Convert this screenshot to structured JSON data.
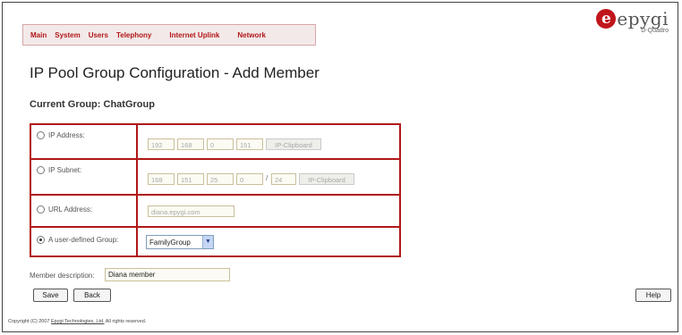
{
  "nav": {
    "items": [
      "Main",
      "System",
      "Users",
      "Telephony",
      "Internet Uplink",
      "Network"
    ]
  },
  "logo": {
    "text": "epygi",
    "subtext": "D-Quadro"
  },
  "page": {
    "title": "IP Pool Group Configuration - Add Member",
    "subtitle": "Current Group: ChatGroup"
  },
  "form": {
    "ip_address": {
      "label": "IP Address:",
      "selected": false,
      "octets": [
        "192",
        "168",
        "0",
        "151"
      ],
      "clipboard_label": "IP-Clipboard"
    },
    "ip_subnet": {
      "label": "IP Subnet:",
      "selected": false,
      "octets": [
        "168",
        "151",
        "25",
        "0"
      ],
      "separator": "/",
      "mask": "24",
      "clipboard_label": "IP-Clipboard"
    },
    "url_address": {
      "label": "URL Address:",
      "selected": false,
      "value": "diana.epygi.com"
    },
    "user_group": {
      "label": "A user-defined Group:",
      "selected": true,
      "value": "FamilyGroup"
    },
    "description": {
      "label": "Member description:",
      "value": "Diana member"
    }
  },
  "buttons": {
    "save": "Save",
    "back": "Back",
    "help": "Help"
  },
  "footer": {
    "prefix": "Copyright (C) 2007 ",
    "link": "Epygi Technologies, Ltd.",
    "suffix": " All rights reserved."
  },
  "colors": {
    "accent": "#b01818",
    "menu_bg": "#f4e9e9"
  }
}
